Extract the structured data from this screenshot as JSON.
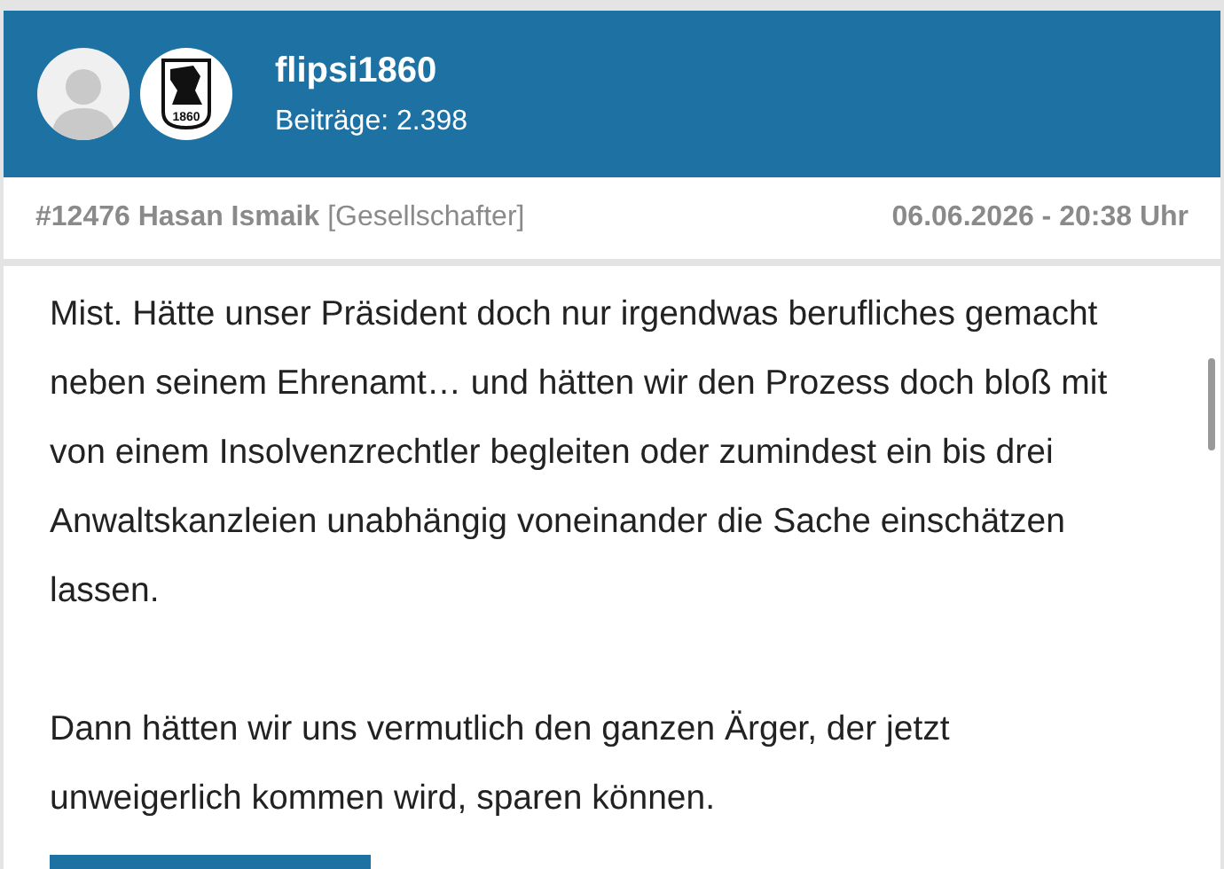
{
  "header": {
    "username": "flipsi1860",
    "posts": "Beiträge: 2.398",
    "club_badge": "1860"
  },
  "post": {
    "title": "**#12476 Hasan Ismaik** [Gesellschafter]",
    "date": "06.06.2026 -  20:38 Uhr",
    "paragraphs": [
      "Mist. Hätte unser Präsident doch nur irgendwas berufliches gemacht neben seinem Ehrenamt… und hätten wir den Prozess doch bloß mit von einem Insolvenzrechtler begleiten oder zumindest ein bis drei Anwaltskanzleien unabhängig voneinander die Sache einschätzen lassen.",
      "Dann hätten wir uns vermutlich den ganzen Ärger, der jetzt unweigerlich kommen wird, sparen können."
    ]
  }
}
